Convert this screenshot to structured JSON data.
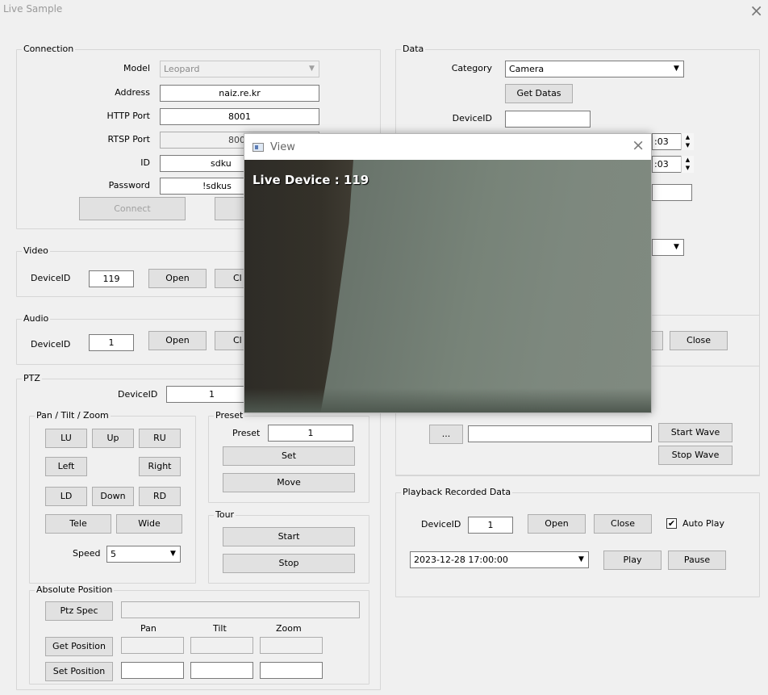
{
  "window": {
    "title": "Live Sample",
    "close": "×"
  },
  "connection": {
    "legend": "Connection",
    "model_label": "Model",
    "model_value": "Leopard",
    "address_label": "Address",
    "address_value": "naiz.re.kr",
    "http_label": "HTTP Port",
    "http_value": "8001",
    "rtsp_label": "RTSP Port",
    "rtsp_value": "800",
    "id_label": "ID",
    "id_value": "sdku",
    "password_label": "Password",
    "password_value": "!sdkus",
    "connect": "Connect"
  },
  "video": {
    "legend": "Video",
    "deviceid_label": "DeviceID",
    "deviceid_value": "119",
    "open": "Open",
    "close_partial": "Cl"
  },
  "audio": {
    "legend": "Audio",
    "deviceid_label": "DeviceID",
    "deviceid_value": "1",
    "open": "Open",
    "close_partial": "Cl",
    "close": "Close"
  },
  "ptz": {
    "legend": "PTZ",
    "deviceid_label": "DeviceID",
    "deviceid_value": "1",
    "pantiltzoom": {
      "legend": "Pan / Tilt / Zoom",
      "lu": "LU",
      "up": "Up",
      "ru": "RU",
      "left": "Left",
      "right": "Right",
      "ld": "LD",
      "down": "Down",
      "rd": "RD",
      "tele": "Tele",
      "wide": "Wide",
      "speed_label": "Speed",
      "speed_value": "5"
    },
    "preset": {
      "legend": "Preset",
      "preset_label": "Preset",
      "preset_value": "1",
      "set": "Set",
      "move": "Move"
    },
    "tour": {
      "legend": "Tour",
      "start": "Start",
      "stop": "Stop"
    },
    "absolute": {
      "legend": "Absolute Position",
      "ptz_spec": "Ptz Spec",
      "pan": "Pan",
      "tilt": "Tilt",
      "zoom": "Zoom",
      "get_position": "Get Position",
      "set_position": "Set Position"
    }
  },
  "data": {
    "legend": "Data",
    "category_label": "Category",
    "category_value": "Camera",
    "get_datas": "Get Datas",
    "deviceid_label": "DeviceID",
    "time1": ":03",
    "time2": ":03"
  },
  "wave": {
    "browse": "...",
    "start": "Start Wave",
    "stop": "Stop Wave"
  },
  "playback": {
    "legend": "Playback Recorded Data",
    "deviceid_label": "DeviceID",
    "deviceid_value": "1",
    "open": "Open",
    "close": "Close",
    "autoplay_label": "Auto Play",
    "autoplay_checked": "✔",
    "datetime": "2023-12-28  17:00:00",
    "play": "Play",
    "pause": "Pause"
  },
  "view": {
    "title": "View",
    "close": "×",
    "overlay": "Live Device : 119"
  }
}
